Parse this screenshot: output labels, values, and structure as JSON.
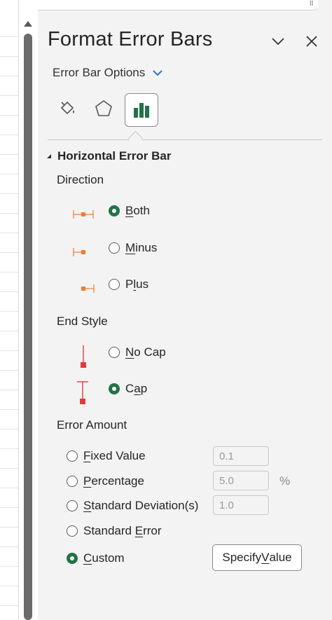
{
  "panel": {
    "title": "Format Error Bars",
    "options_dropdown": "Error Bar Options",
    "tabs": [
      {
        "icon": "fill-line-icon",
        "selected": false
      },
      {
        "icon": "effects-pentagon-icon",
        "selected": false
      },
      {
        "icon": "bar-chart-options-icon",
        "selected": true
      }
    ]
  },
  "horizontal": {
    "section_title": "Horizontal Error Bar",
    "direction": {
      "label": "Direction",
      "options": [
        {
          "first": "B",
          "rest": "oth",
          "selected": true
        },
        {
          "first": "M",
          "rest": "inus",
          "selected": false
        },
        {
          "pre": "P",
          "first": "l",
          "rest": "us",
          "selected": false
        }
      ]
    },
    "end_style": {
      "label": "End Style",
      "options": [
        {
          "first": "N",
          "rest": "o Cap",
          "selected": false
        },
        {
          "pre": "C",
          "first": "a",
          "rest": "p",
          "selected": true
        }
      ]
    },
    "error_amount": {
      "label": "Error Amount",
      "fixed_value": {
        "first": "F",
        "rest": "ixed Value",
        "value": "0.1",
        "selected": false
      },
      "percentage": {
        "first": "P",
        "rest": "ercentage",
        "value": "5.0",
        "unit": "%",
        "selected": false
      },
      "std_dev": {
        "first": "S",
        "rest": "tandard Deviation(s)",
        "value": "1.0",
        "selected": false
      },
      "std_error": {
        "pre": "Standard ",
        "first": "E",
        "rest": "rror",
        "selected": false
      },
      "custom": {
        "first": "C",
        "rest": "ustom",
        "selected": true
      },
      "specify_button": {
        "pre": "Specify ",
        "first": "V",
        "rest": "alue"
      }
    }
  },
  "colors": {
    "accent": "#217346",
    "direction_glyph": "#ED7D31",
    "endstyle_glyph": "#E03C3C"
  }
}
